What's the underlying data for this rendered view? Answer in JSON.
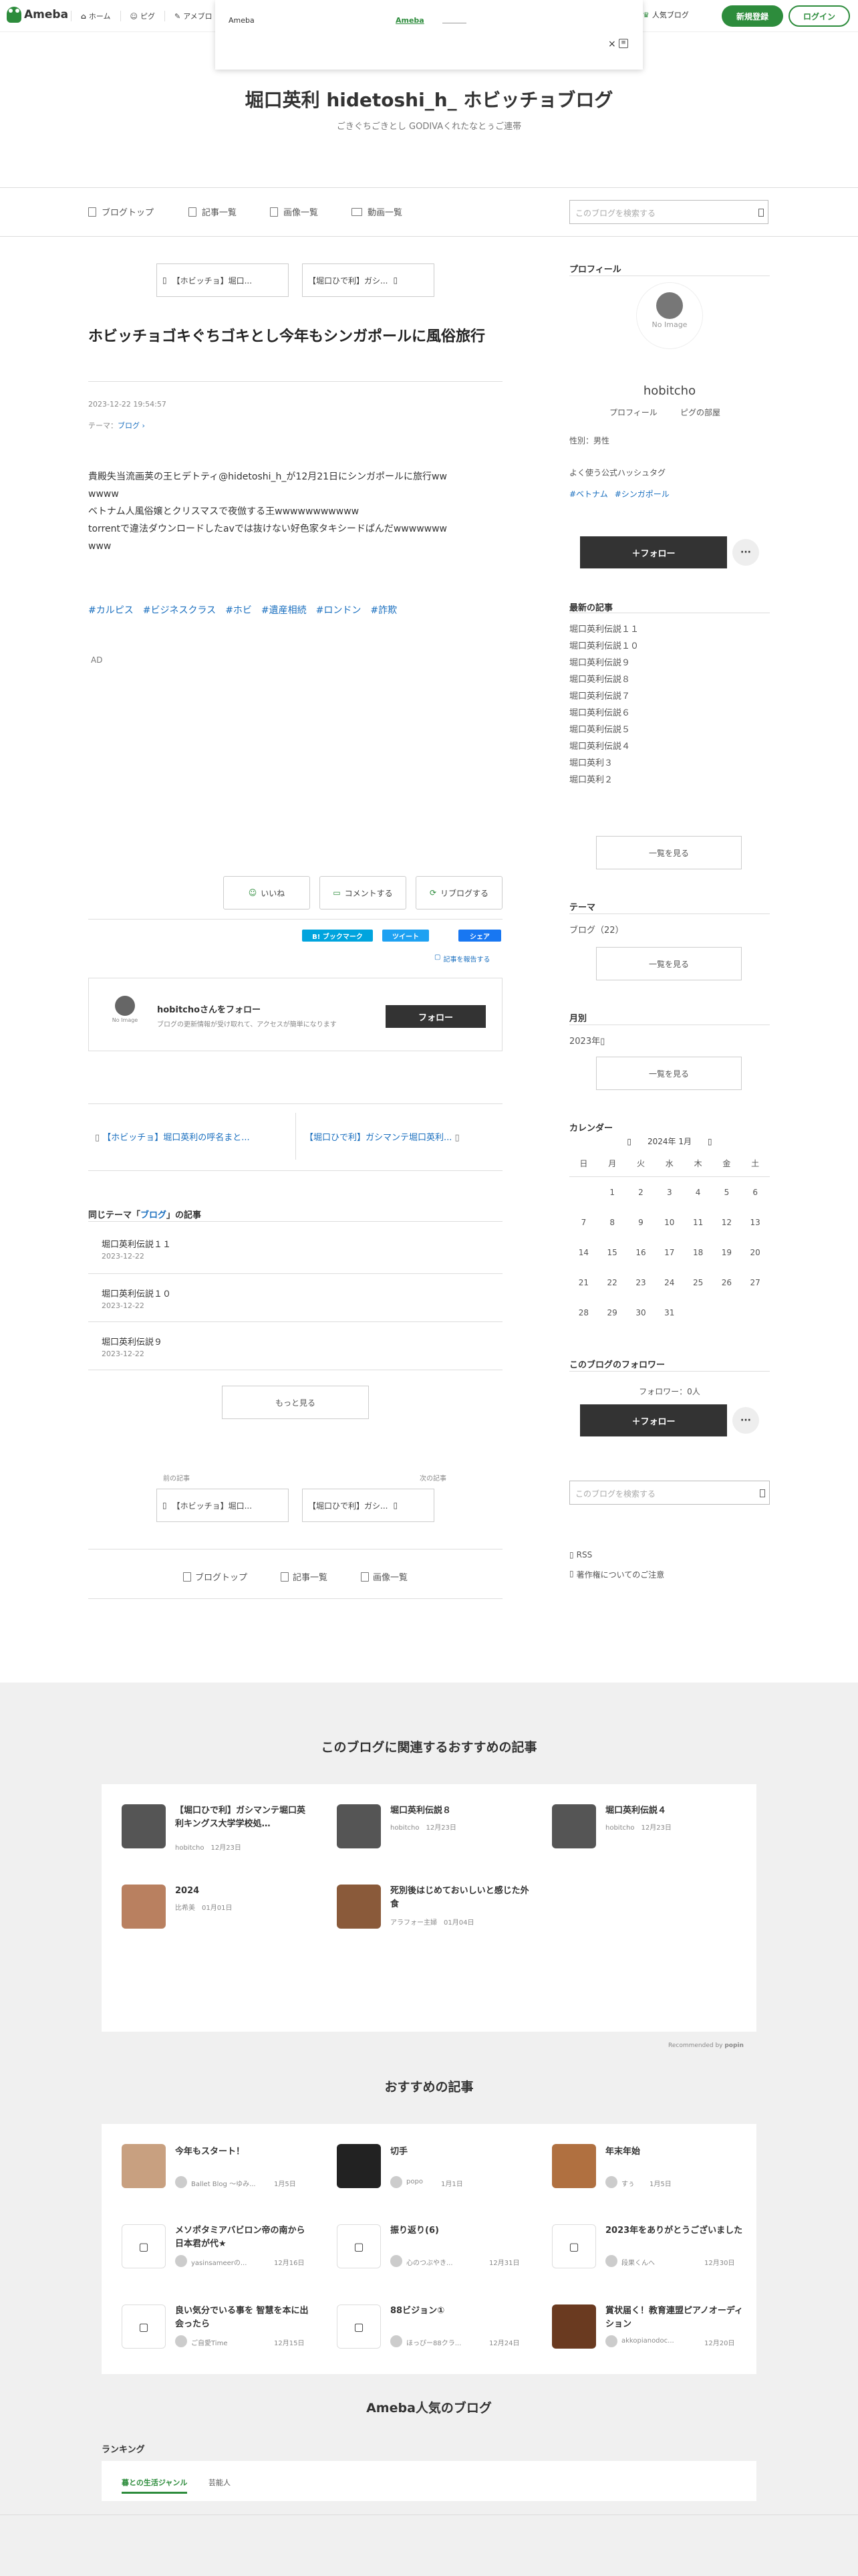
{
  "header": {
    "logo": "Ameba",
    "nav": [
      "ホーム",
      "ピグ",
      "アメブロ"
    ],
    "popup_label": "Ameba",
    "popup_link": "Ameba",
    "popup_close": "×",
    "popular_blog": "人気ブログ",
    "signup": "新規登録",
    "login": "ログイン"
  },
  "blog": {
    "title": "堀口英利 hidetoshi_h_ ホビッチョブログ",
    "subtitle": "ごきぐちごきとし GODIVAくれたなとぅご連帯"
  },
  "blognav": {
    "items": [
      "ブログトップ",
      "記事一覧",
      "画像一覧",
      "動画一覧"
    ],
    "search_placeholder": "このブログを検索する"
  },
  "pager": {
    "prev": "【ホビッチョ】堀口...",
    "next": "【堀口ひで利】ガシ..."
  },
  "article": {
    "title": "ホビッチョゴキぐちゴキとし今年もシンガポールに風俗旅行",
    "datetime": "2023-12-22 19:54:57",
    "theme_label": "テーマ：",
    "theme": "ブログ",
    "body_lines": [
      "貴殿失当流画荚の王ヒデトティ@hidetoshi_h_が12月21日にシンガポールに旅行ww",
      "wwww",
      "ベトナム人風俗嬢とクリスマスで夜倣する王wwwwwwwwwww",
      "torrentで違法ダウンロードしたavでは抜けない好色家タキシードぱんだwwwwwww",
      "www"
    ],
    "tags": [
      "#カルピス",
      "#ビジネスクラス",
      "#ホビ",
      "#遺産相続",
      "#ロンドン",
      "#詐欺"
    ],
    "ad": "AD"
  },
  "actions": {
    "like": "いいね",
    "comment": "コメントする",
    "reblog": "リブログする",
    "hatena": "B! ブックマーク",
    "tweet": "ツイート",
    "fb": "シェア",
    "report": "記事を報告する"
  },
  "followbox": {
    "name": "hobitchoさんをフォロー",
    "desc": "ブログの更新情報が受け取れて、アクセスが簡単になります",
    "button": "フォロー",
    "noimage": "No Image"
  },
  "prevnext": {
    "prev": "【ホビッチョ】堀口英利の呼名まと...",
    "next": "【堀口ひで利】ガシマンテ堀口英利..."
  },
  "related_theme": {
    "heading_pre": "同じテーマ「",
    "theme": "ブログ",
    "heading_post": "」の記事",
    "items": [
      {
        "title": "堀口英利伝説１１",
        "date": "2023-12-22"
      },
      {
        "title": "堀口英利伝説１０",
        "date": "2023-12-22"
      },
      {
        "title": "堀口英利伝説９",
        "date": "2023-12-22"
      }
    ],
    "more": "もっと見る"
  },
  "bottom_pager": {
    "prev_label": "前の記事",
    "next_label": "次の記事",
    "prev": "【ホビッチョ】堀口...",
    "next": "【堀口ひで利】ガシ..."
  },
  "footer_nav": [
    "ブログトップ",
    "記事一覧",
    "画像一覧"
  ],
  "sidebar": {
    "profile_title": "プロフィール",
    "noimage": "No Image",
    "name": "hobitcho",
    "profile_link": "プロフィール",
    "room_link": "ピグの部屋",
    "gender": "性別：男性",
    "hashtag_title": "よく使う公式ハッシュタグ",
    "hashtags": [
      "#ベトナム",
      "#シンガポール"
    ],
    "follow": "＋フォロー",
    "more_icon": "···",
    "recent_title": "最新の記事",
    "recent": [
      "堀口英利伝説１１",
      "堀口英利伝説１０",
      "堀口英利伝説９",
      "堀口英利伝説８",
      "堀口英利伝説７",
      "堀口英利伝説６",
      "堀口英利伝説５",
      "堀口英利伝説４",
      "堀口英利３",
      "堀口英利２"
    ],
    "see_all": "一覧を見る",
    "theme_title": "テーマ",
    "theme_item": "ブログ（22）",
    "month_title": "月別",
    "month_item": "2023年",
    "calendar_title": "カレンダー",
    "calendar_month": "2024年 1月",
    "weekdays": [
      "日",
      "月",
      "火",
      "水",
      "木",
      "金",
      "土"
    ],
    "weeks": [
      [
        "",
        "1",
        "2",
        "3",
        "4",
        "5",
        "6"
      ],
      [
        "7",
        "8",
        "9",
        "10",
        "11",
        "12",
        "13"
      ],
      [
        "14",
        "15",
        "16",
        "17",
        "18",
        "19",
        "20"
      ],
      [
        "21",
        "22",
        "23",
        "24",
        "25",
        "26",
        "27"
      ],
      [
        "28",
        "29",
        "30",
        "31",
        "",
        "",
        ""
      ]
    ],
    "followers_title": "このブログのフォロワー",
    "followers_count": "フォロワー：0人",
    "search_placeholder": "このブログを検索する",
    "rss": "RSS",
    "copyright": "著作権についてのご注意"
  },
  "recommend": {
    "title": "このブログに関連するおすすめの記事",
    "items": [
      {
        "title": "【堀口ひで利】ガシマンテ堀口英利キングス大学学校処…",
        "author": "hobitcho",
        "date": "12月23日"
      },
      {
        "title": "堀口英利伝説８",
        "author": "hobitcho",
        "date": "12月23日"
      },
      {
        "title": "堀口英利伝説４",
        "author": "hobitcho",
        "date": "12月23日"
      },
      {
        "title": "2024",
        "author": "比希美",
        "date": "01月01日"
      },
      {
        "title": "死別後はじめておいしいと感じた外食",
        "author": "アラフォー主婦",
        "date": "01月04日"
      }
    ],
    "recommended_by": "Recommended by",
    "popin": "popin"
  },
  "osusume": {
    "title": "おすすめの記事",
    "items": [
      {
        "title": "今年もスタート！",
        "author": "Ballet Blog ～ゆみ...",
        "date": "1月5日"
      },
      {
        "title": "切手",
        "author": "popo",
        "date": "1月1日"
      },
      {
        "title": "年末年始",
        "author": "すぅ",
        "date": "1月5日"
      },
      {
        "title": "メソポタミアバビロン帝の南から日本君が代★",
        "author": "yasinsameerの...",
        "date": "12月16日"
      },
      {
        "title": "振り返り(6)",
        "author": "心のつぶやき...",
        "date": "12月31日"
      },
      {
        "title": "2023年をありがとうございました",
        "author": "段果くんへ",
        "date": "12月30日"
      },
      {
        "title": "良い気分でいる事を 智慧を本に出会ったら",
        "author": "ご自愛Time",
        "date": "12月15日"
      },
      {
        "title": "88ビジョン①",
        "author": "ほっぴー88クラ...",
        "date": "12月24日"
      },
      {
        "title": "賞状届く！教育連盟ピアノオーディション",
        "author": "akkopianodoc...",
        "date": "12月20日"
      }
    ]
  },
  "popular": {
    "title": "Ameba人気のブログ",
    "ranking": "ランキング",
    "tabs": [
      "暮との生活ジャンル",
      "芸能人"
    ]
  }
}
